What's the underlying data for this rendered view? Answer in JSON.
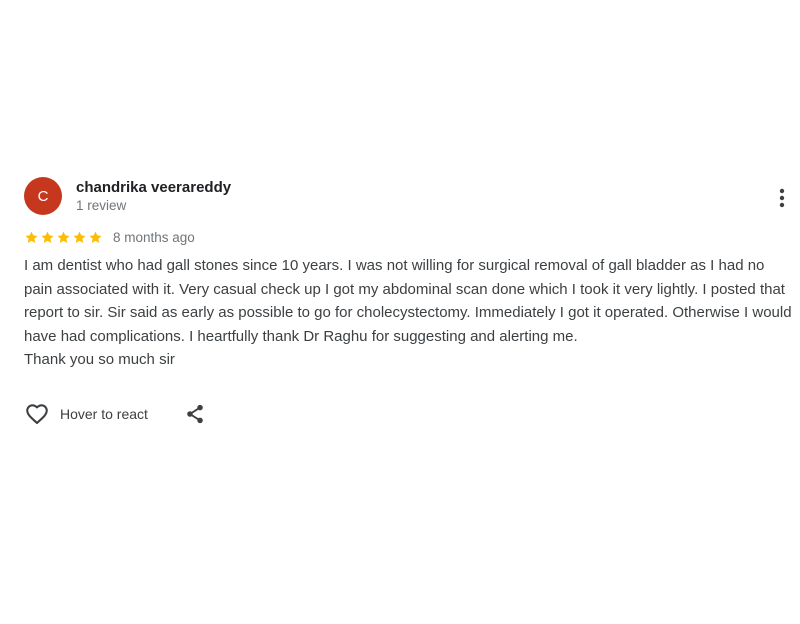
{
  "review": {
    "avatar_letter": "C",
    "avatar_color": "#c5381e",
    "reviewer_name": "chandrika veerareddy",
    "review_count": "1 review",
    "rating": 5,
    "rating_max": 5,
    "star_color": "#fbbc04",
    "date": "8 months ago",
    "text": "I am dentist who had gall stones since 10 years. I was not willing for surgical removal of gall bladder as I had no pain associated with it. Very casual check up I got my abdominal scan done which I took it very lightly. I posted that report to sir. Sir said as early as possible to go for cholecystectomy. Immediately I got it operated. Otherwise I would have had complications. I heartfully thank Dr Raghu for suggesting and alerting me.\nThank you so much sir",
    "more_icon": "more-vert-icon"
  },
  "actions": {
    "react_label": "Hover to react",
    "react_icon": "heart-outline-icon",
    "share_icon": "share-icon"
  }
}
